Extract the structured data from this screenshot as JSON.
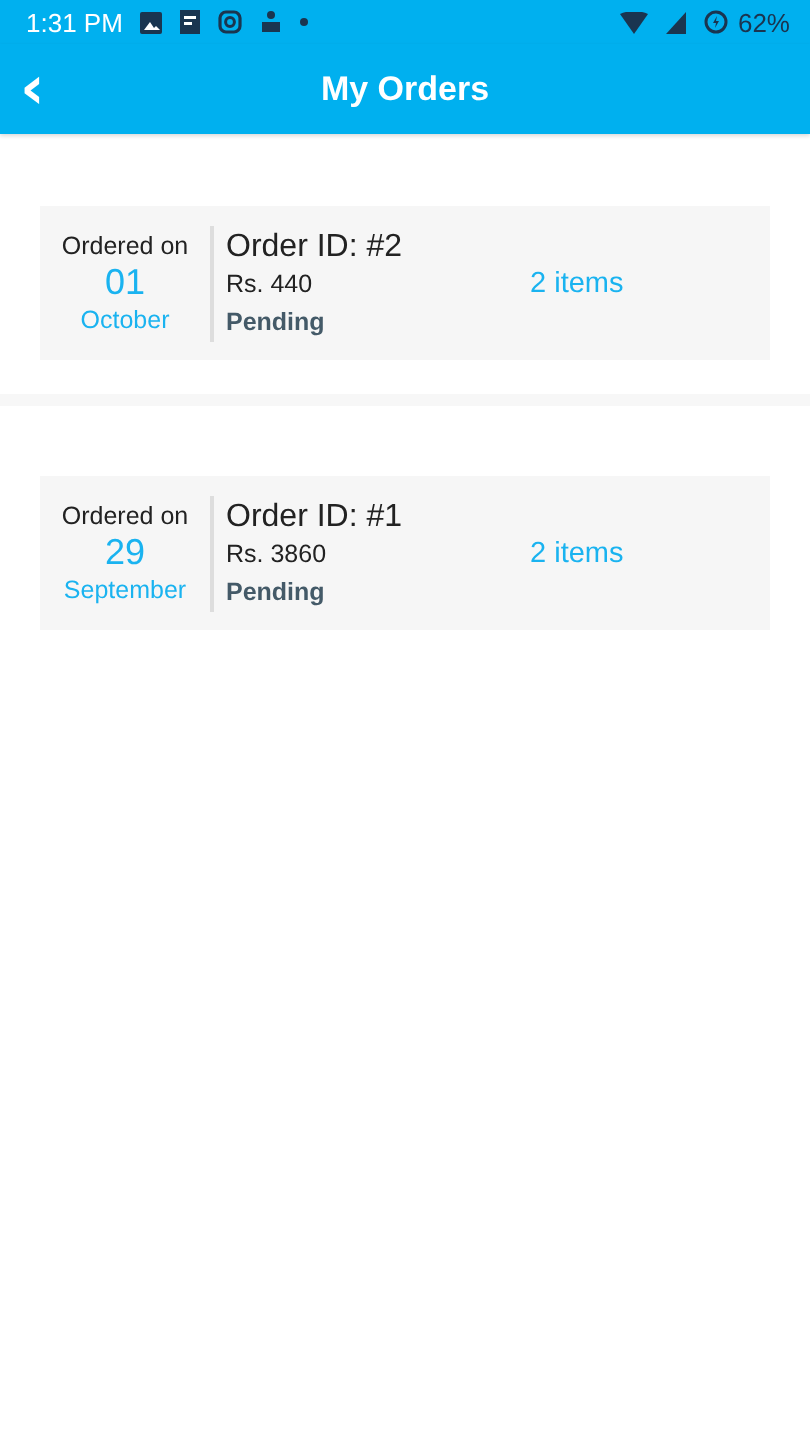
{
  "status_bar": {
    "time": "1:31 PM",
    "battery": "62%"
  },
  "app_bar": {
    "back": "‹",
    "title": "My Orders"
  },
  "orders": [
    {
      "date_label": "Ordered on",
      "day": "01",
      "month": "October",
      "order_id": "Order ID: #2",
      "price": "Rs. 440",
      "status": "Pending",
      "items": "2 items"
    },
    {
      "date_label": "Ordered on",
      "day": "29",
      "month": "September",
      "order_id": "Order ID: #1",
      "price": "Rs. 3860",
      "status": "Pending",
      "items": "2 items"
    }
  ]
}
